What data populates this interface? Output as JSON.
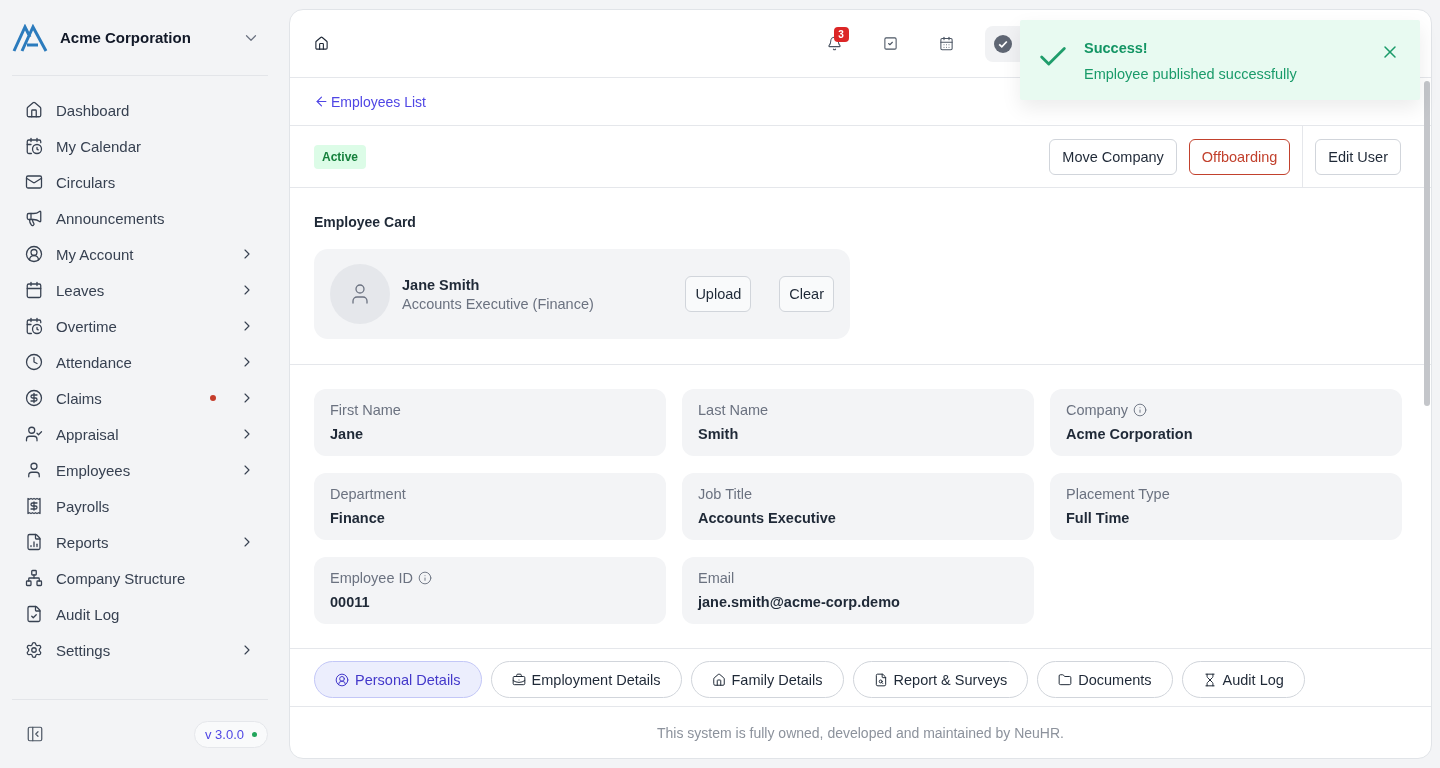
{
  "sidebar": {
    "company": "Acme Corporation",
    "items": [
      {
        "label": "Dashboard",
        "selected": false,
        "has_submenu": false,
        "alert": false
      },
      {
        "label": "My Calendar",
        "selected": false,
        "has_submenu": false,
        "alert": false
      },
      {
        "label": "Circulars",
        "selected": false,
        "has_submenu": false,
        "alert": false
      },
      {
        "label": "Announcements",
        "selected": false,
        "has_submenu": false,
        "alert": false
      },
      {
        "label": "My Account",
        "selected": false,
        "has_submenu": true,
        "alert": false
      },
      {
        "label": "Leaves",
        "selected": false,
        "has_submenu": true,
        "alert": false
      },
      {
        "label": "Overtime",
        "selected": false,
        "has_submenu": true,
        "alert": false
      },
      {
        "label": "Attendance",
        "selected": false,
        "has_submenu": true,
        "alert": false
      },
      {
        "label": "Claims",
        "selected": false,
        "has_submenu": true,
        "alert": true
      },
      {
        "label": "Appraisal",
        "selected": false,
        "has_submenu": true,
        "alert": false
      },
      {
        "label": "Employees",
        "selected": false,
        "has_submenu": true,
        "alert": false
      },
      {
        "label": "Payrolls",
        "selected": false,
        "has_submenu": false,
        "alert": false
      },
      {
        "label": "Reports",
        "selected": false,
        "has_submenu": true,
        "alert": false
      },
      {
        "label": "Company Structure",
        "selected": false,
        "has_submenu": false,
        "alert": false
      },
      {
        "label": "Audit Log",
        "selected": false,
        "has_submenu": false,
        "alert": false
      },
      {
        "label": "Settings",
        "selected": false,
        "has_submenu": true,
        "alert": false
      }
    ],
    "version": "v 3.0.0"
  },
  "header": {
    "notification_count": "3"
  },
  "toast": {
    "title": "Success!",
    "message": "Employee published successfully"
  },
  "back_link": "Employees List",
  "status_badge": "Active",
  "actions": [
    {
      "label": "Move Company",
      "kind": "outline",
      "separated": false
    },
    {
      "label": "Offboarding",
      "kind": "danger",
      "separated": false
    },
    {
      "label": "Edit User",
      "kind": "outline",
      "separated": true
    }
  ],
  "employee_card": {
    "title": "Employee Card",
    "name": "Jane Smith",
    "role": "Accounts Executive (Finance)",
    "buttons": [
      "Upload",
      "Clear"
    ]
  },
  "fields": [
    {
      "label": "First Name",
      "value": "Jane",
      "info": false
    },
    {
      "label": "Last Name",
      "value": "Smith",
      "info": false
    },
    {
      "label": "Company",
      "value": "Acme Corporation",
      "info": true
    },
    {
      "label": "Department",
      "value": "Finance",
      "info": false
    },
    {
      "label": "Job Title",
      "value": "Accounts Executive",
      "info": false
    },
    {
      "label": "Placement Type",
      "value": "Full Time",
      "info": false
    },
    {
      "label": "Employee ID",
      "value": "00011",
      "info": true
    },
    {
      "label": "Email",
      "value": "jane.smith@acme-corp.demo",
      "info": false
    }
  ],
  "tabs": [
    {
      "label": "Personal Details",
      "selected": true
    },
    {
      "label": "Employment Details",
      "selected": false
    },
    {
      "label": "Family Details",
      "selected": false
    },
    {
      "label": "Report & Surveys",
      "selected": false
    },
    {
      "label": "Documents",
      "selected": false
    },
    {
      "label": "Audit Log",
      "selected": false
    }
  ],
  "footer": "This system is fully owned, developed and maintained by NeuHR."
}
